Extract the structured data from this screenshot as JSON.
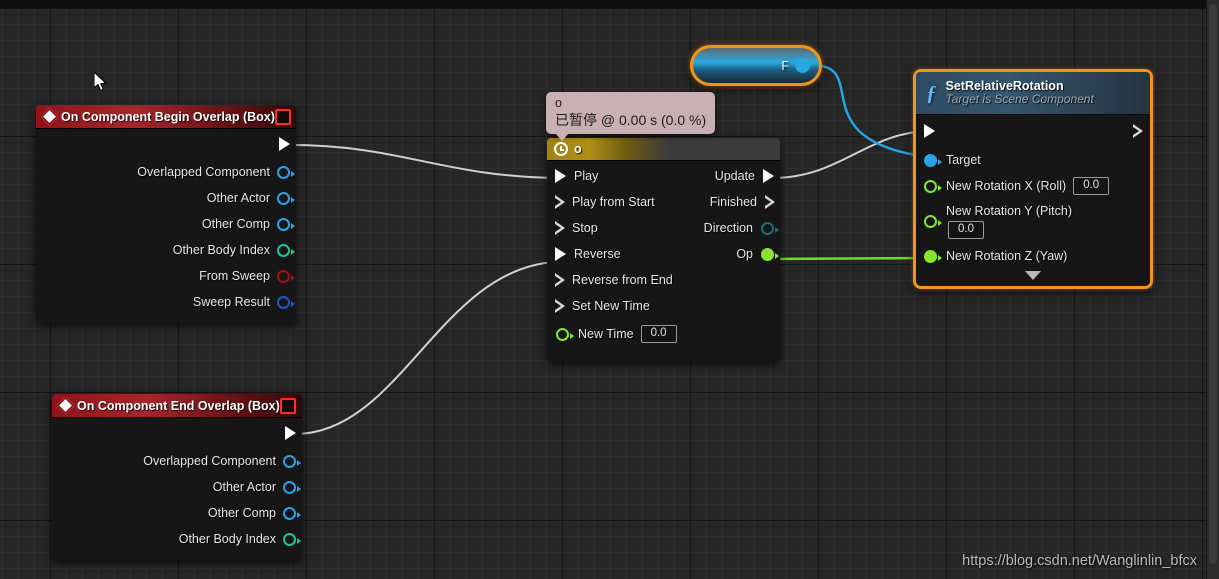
{
  "app": {
    "editor": "Unreal Engine Blueprint Event Graph",
    "watermark": "https://blog.csdn.net/Wanglinlin_bfcx"
  },
  "debug_bubble": {
    "line1": "o",
    "line2": "已暂停 @ 0.00 s (0.0 %)"
  },
  "nodes": {
    "begin_overlap": {
      "title": "On Component Begin Overlap (Box)",
      "icon": "event-diamond-icon",
      "badge": "red-square-icon",
      "exec_out_label": "",
      "outputs": [
        {
          "label": "Overlapped Component",
          "type": "obj"
        },
        {
          "label": "Other Actor",
          "type": "obj"
        },
        {
          "label": "Other Comp",
          "type": "obj"
        },
        {
          "label": "Other Body Index",
          "type": "int"
        },
        {
          "label": "From Sweep",
          "type": "bool"
        },
        {
          "label": "Sweep Result",
          "type": "struct"
        }
      ]
    },
    "end_overlap": {
      "title": "On Component End Overlap (Box)",
      "icon": "event-diamond-icon",
      "badge": "red-square-icon",
      "outputs": [
        {
          "label": "Overlapped Component",
          "type": "obj"
        },
        {
          "label": "Other Actor",
          "type": "obj"
        },
        {
          "label": "Other Comp",
          "type": "obj"
        },
        {
          "label": "Other Body Index",
          "type": "int"
        }
      ]
    },
    "timeline": {
      "title": "o",
      "icon": "clock-icon",
      "inputs": [
        {
          "label": "Play",
          "connected": true
        },
        {
          "label": "Play from Start",
          "connected": false
        },
        {
          "label": "Stop",
          "connected": false
        },
        {
          "label": "Reverse",
          "connected": true
        },
        {
          "label": "Reverse from End",
          "connected": false
        },
        {
          "label": "Set New Time",
          "connected": false
        }
      ],
      "new_time": {
        "label": "New Time",
        "value": "0.0",
        "type": "float"
      },
      "outputs": [
        {
          "label": "Update",
          "kind": "exec",
          "connected": true
        },
        {
          "label": "Finished",
          "kind": "exec",
          "connected": false
        },
        {
          "label": "Direction",
          "kind": "data",
          "type": "dir"
        },
        {
          "label": "Op",
          "kind": "data",
          "type": "float"
        }
      ]
    },
    "variable_getter": {
      "label": "F",
      "pin_type": "obj",
      "selected": true
    },
    "set_relative_rotation": {
      "title": "SetRelativeRotation",
      "subtitle": "Target is Scene Component",
      "icon": "function-f-icon",
      "selected": true,
      "inputs": [
        {
          "label": "Target",
          "type": "obj",
          "filled": true
        },
        {
          "label": "New Rotation X (Roll)",
          "type": "float",
          "value": "0.0",
          "filled": false
        },
        {
          "label": "New Rotation Y (Pitch)",
          "type": "float",
          "value": "0.0",
          "filled": false
        },
        {
          "label": "New Rotation Z (Yaw)",
          "type": "float",
          "value": "",
          "filled": true
        }
      ],
      "expand": "expand-down-arrow"
    }
  },
  "colors": {
    "exec_white": "#ffffff",
    "object_blue": "#2aa3e8",
    "int_green": "#17c79a",
    "bool_red": "#a41010",
    "struct_blue": "#1c57c9",
    "float_green": "#8ce22f",
    "selection_orange": "#f3931a",
    "event_red": "#a6262b",
    "timeline_gold": "#b08f18",
    "function_blue": "#34566f"
  }
}
